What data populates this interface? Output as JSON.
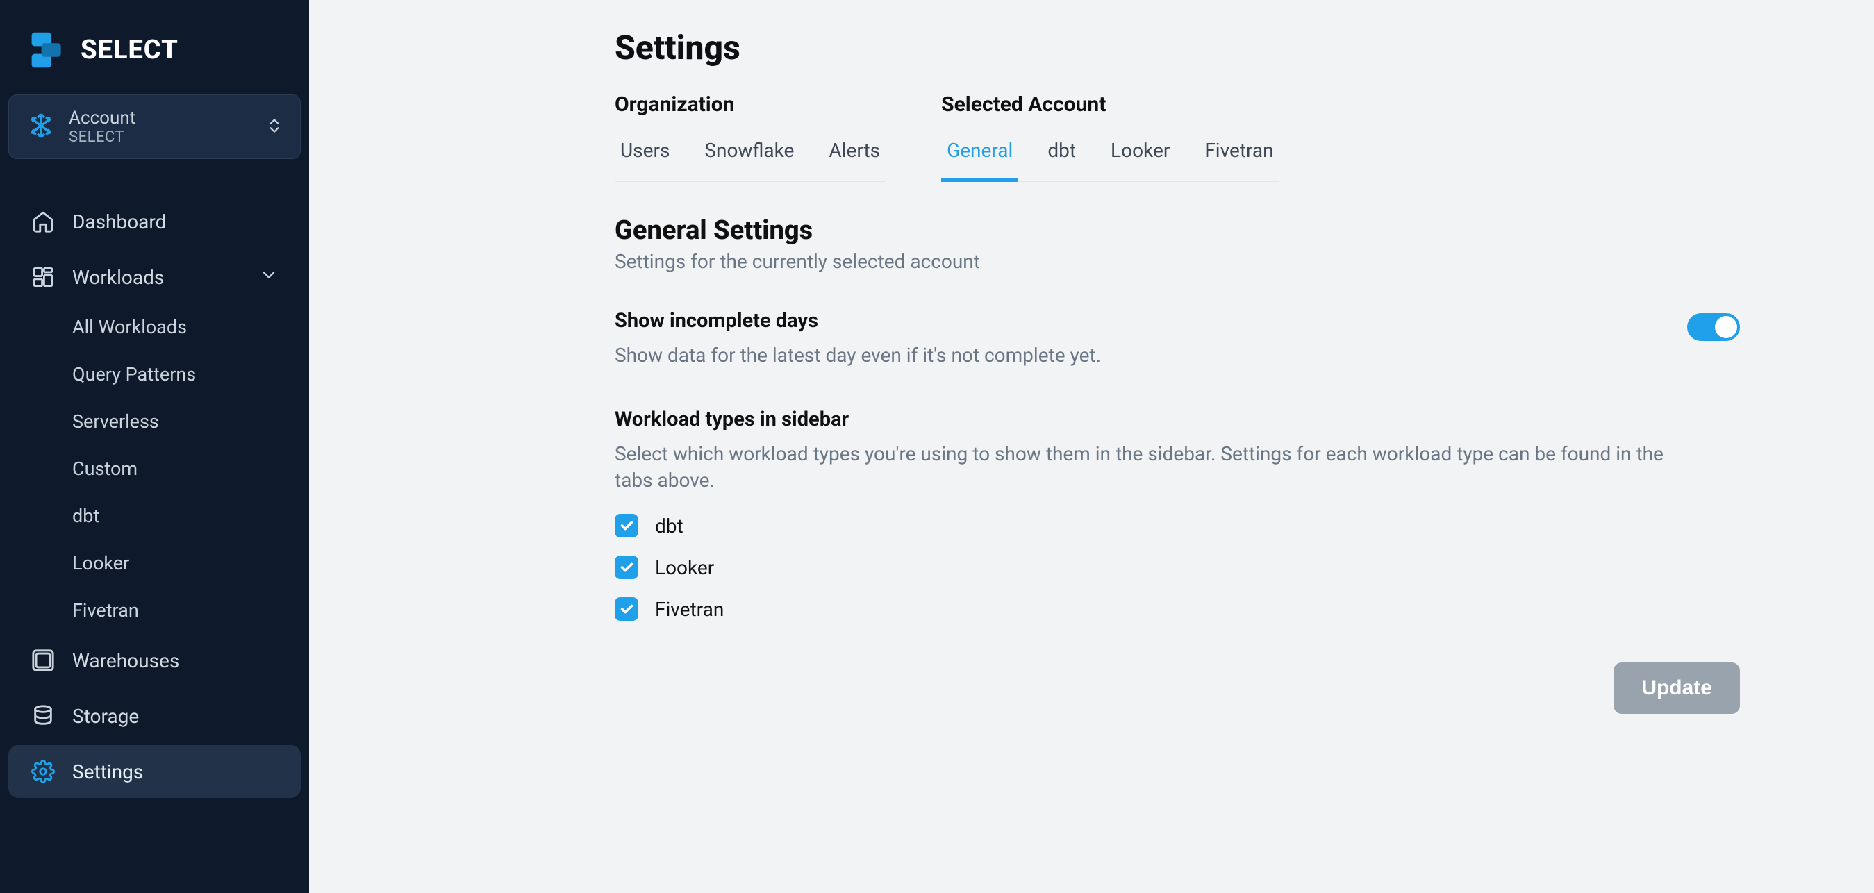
{
  "brand": {
    "name": "SELECT",
    "accent": "#1fa0e8"
  },
  "account_switcher": {
    "label": "Account",
    "name": "SELECT"
  },
  "sidebar": {
    "items": [
      {
        "icon": "home-icon",
        "label": "Dashboard",
        "active": false,
        "expandable": false
      },
      {
        "icon": "workloads-icon",
        "label": "Workloads",
        "active": false,
        "expandable": true,
        "expanded": true
      },
      {
        "icon": "warehouse-icon",
        "label": "Warehouses",
        "active": false,
        "expandable": false
      },
      {
        "icon": "storage-icon",
        "label": "Storage",
        "active": false,
        "expandable": false
      },
      {
        "icon": "gear-icon",
        "label": "Settings",
        "active": true,
        "expandable": false
      }
    ],
    "workload_subitems": [
      {
        "label": "All Workloads"
      },
      {
        "label": "Query Patterns"
      },
      {
        "label": "Serverless"
      },
      {
        "label": "Custom"
      },
      {
        "label": "dbt"
      },
      {
        "label": "Looker"
      },
      {
        "label": "Fivetran"
      }
    ]
  },
  "page": {
    "title": "Settings",
    "tab_groups": {
      "organization": {
        "label": "Organization",
        "tabs": [
          {
            "label": "Users",
            "active": false
          },
          {
            "label": "Snowflake",
            "active": false
          },
          {
            "label": "Alerts",
            "active": false
          }
        ]
      },
      "selected_account": {
        "label": "Selected Account",
        "tabs": [
          {
            "label": "General",
            "active": true
          },
          {
            "label": "dbt",
            "active": false
          },
          {
            "label": "Looker",
            "active": false
          },
          {
            "label": "Fivetran",
            "active": false
          }
        ]
      }
    },
    "section": {
      "heading": "General Settings",
      "subtext": "Settings for the currently selected account"
    },
    "settings": {
      "show_incomplete_days": {
        "label": "Show incomplete days",
        "description": "Show data for the latest day even if it's not complete yet.",
        "enabled": true
      },
      "workload_types": {
        "label": "Workload types in sidebar",
        "description": "Select which workload types you're using to show them in the sidebar. Settings for each workload type can be found in the tabs above.",
        "options": [
          {
            "label": "dbt",
            "checked": true
          },
          {
            "label": "Looker",
            "checked": true
          },
          {
            "label": "Fivetran",
            "checked": true
          }
        ]
      }
    },
    "update_button": "Update"
  }
}
